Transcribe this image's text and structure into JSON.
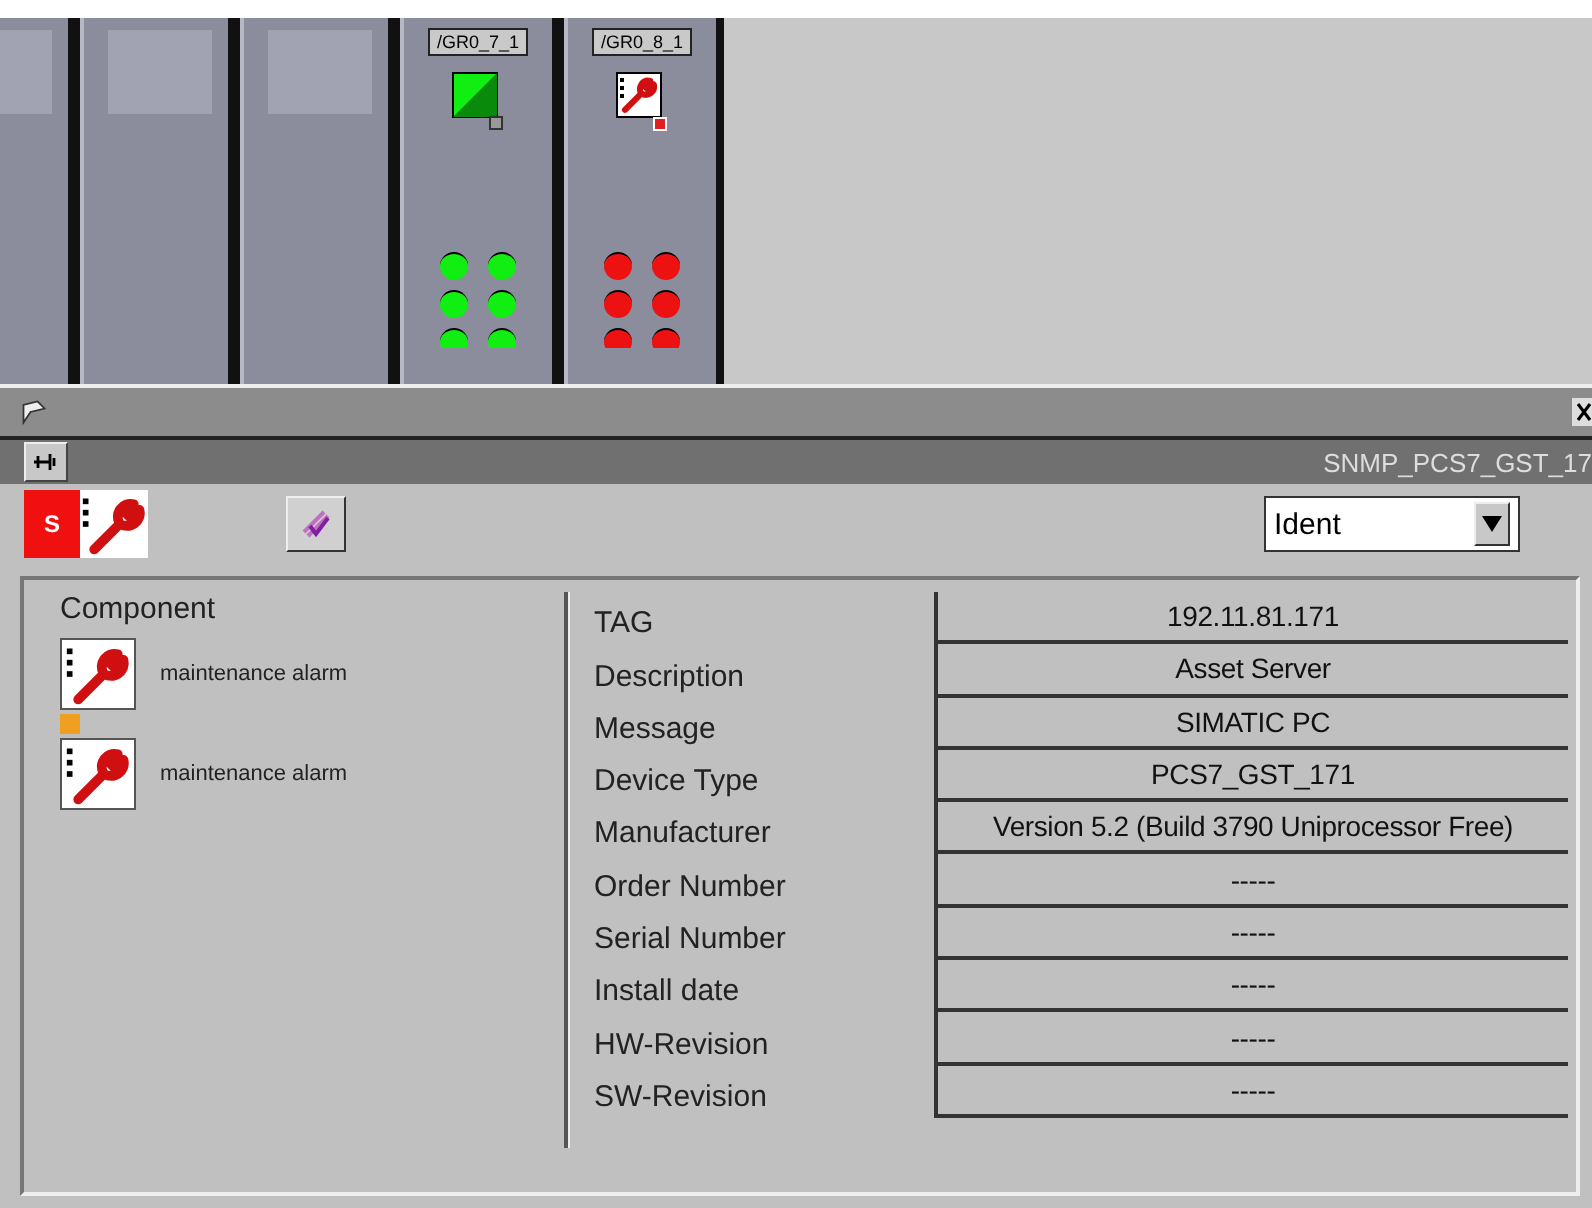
{
  "rack": {
    "modules": [
      {
        "kind": "empty"
      },
      {
        "kind": "empty"
      },
      {
        "kind": "empty"
      },
      {
        "kind": "device",
        "label": "/GR0_7_1",
        "maintenance": false,
        "leds": [
          {
            "color": "#11ee11"
          },
          {
            "color": "#11ee11"
          },
          {
            "color": "#11ee11"
          },
          {
            "color": "#11ee11"
          },
          {
            "color": "#11ee11"
          },
          {
            "color": "#11ee11"
          }
        ]
      },
      {
        "kind": "device",
        "label": "/GR0_8_1",
        "maintenance": true,
        "leds": [
          {
            "color": "#ee1111"
          },
          {
            "color": "#ee1111"
          },
          {
            "color": "#ee1111"
          },
          {
            "color": "#ee1111"
          },
          {
            "color": "#ee1111"
          },
          {
            "color": "#ee1111"
          }
        ]
      }
    ]
  },
  "faceplate": {
    "title": "SNMP_PCS7_GST_17",
    "toolbar": {
      "status_letter": "S",
      "view": {
        "value": "Ident"
      }
    },
    "components": {
      "heading": "Component",
      "items": [
        {
          "text": "maintenance alarm",
          "marker": true
        },
        {
          "text": "maintenance alarm",
          "marker": false
        }
      ]
    },
    "fields": [
      {
        "label": "TAG",
        "value": "192.11.81.171"
      },
      {
        "label": "Description",
        "value": "Asset Server"
      },
      {
        "label": "Message",
        "value": "SIMATIC PC"
      },
      {
        "label": "Device Type",
        "value": "PCS7_GST_171"
      },
      {
        "label": "Manufacturer",
        "value": "Version 5.2 (Build 3790 Uniprocessor Free)"
      },
      {
        "label": "Order Number",
        "value": "-----"
      },
      {
        "label": "Serial Number",
        "value": "-----"
      },
      {
        "label": "Install date",
        "value": "-----"
      },
      {
        "label": "HW-Revision",
        "value": "-----"
      },
      {
        "label": "SW-Revision",
        "value": "-----"
      }
    ]
  }
}
